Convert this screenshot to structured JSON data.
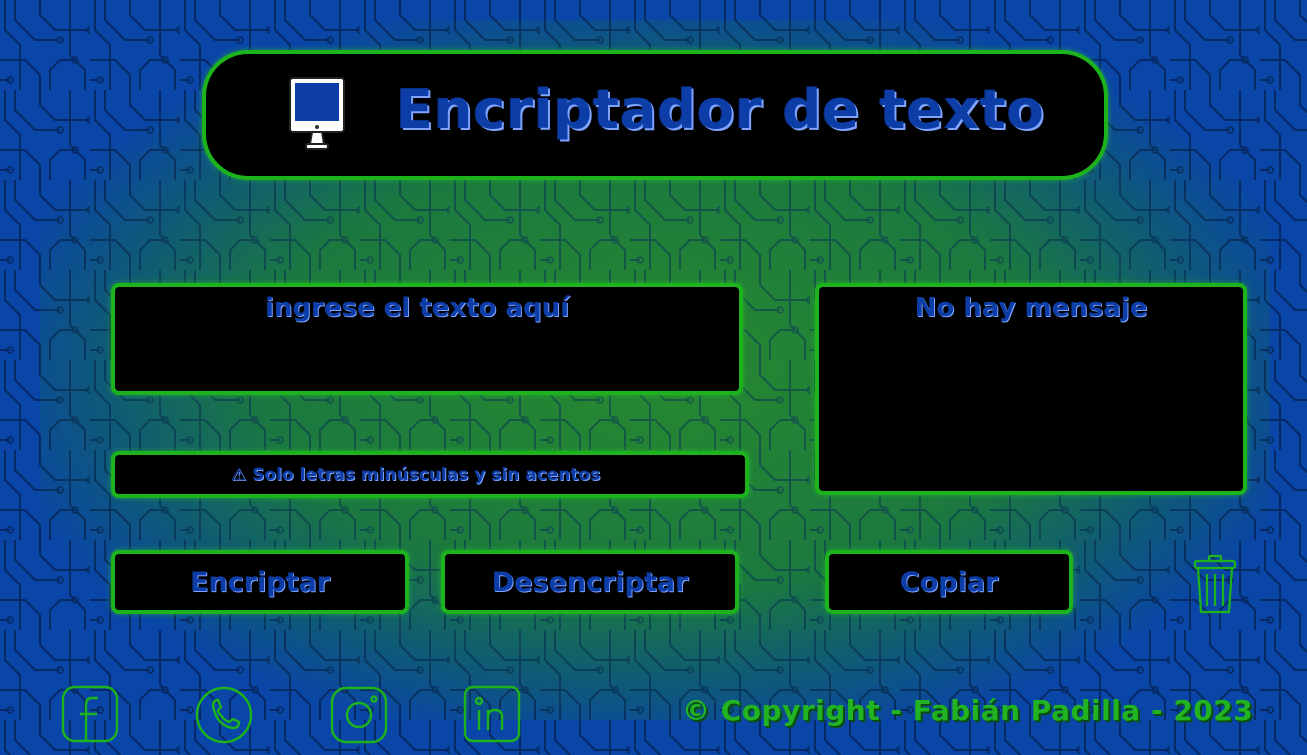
{
  "header": {
    "title": "Encriptador de texto",
    "icon": "monitor-icon"
  },
  "input": {
    "placeholder": "ingrese el texto aquí"
  },
  "output": {
    "message": "No hay mensaje"
  },
  "warning": {
    "icon": "warning-icon",
    "text": "⚠ Solo letras minúsculas y sin acentos"
  },
  "buttons": {
    "encrypt": "Encriptar",
    "decrypt": "Desencriptar",
    "copy": "Copiar",
    "clear_icon": "trash-icon"
  },
  "social": [
    {
      "icon": "facebook-icon"
    },
    {
      "icon": "whatsapp-icon"
    },
    {
      "icon": "instagram-icon"
    },
    {
      "icon": "linkedin-icon"
    }
  ],
  "footer": {
    "copyright": "© Copyright - Fabián Padilla - 2023"
  },
  "colors": {
    "background": "#0a45a8",
    "border_green": "#1db31d",
    "text_blue": "#0d3da6",
    "footer_green": "#22b322"
  }
}
